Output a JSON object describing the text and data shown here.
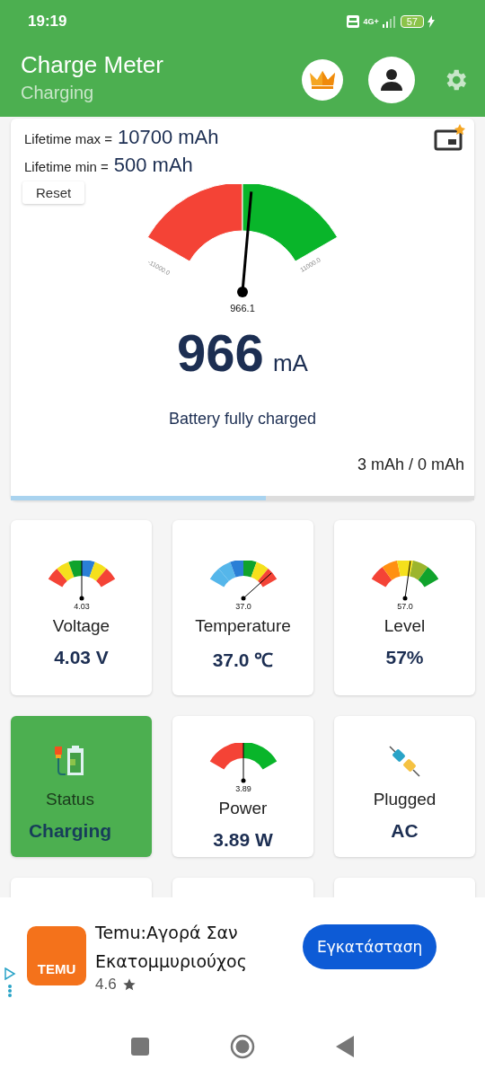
{
  "status_bar": {
    "time": "19:19",
    "network": "4G+",
    "battery": "57"
  },
  "app_bar": {
    "title": "Charge Meter",
    "subtitle": "Charging"
  },
  "summary": {
    "lifetime_max_label": "Lifetime max =",
    "lifetime_max": "10700 mAh",
    "lifetime_min_label": "Lifetime min =",
    "lifetime_min": "500 mAh",
    "reset_button": "Reset",
    "gauge": {
      "min_label": "-11000.0",
      "max_label": "11000.0",
      "reading": "966.1",
      "segments": [
        {
          "color": "#f44336"
        },
        {
          "color": "#09b52a"
        }
      ]
    },
    "current": "966",
    "unit": "mA",
    "message": "Battery fully charged",
    "capacity": "3 mAh / 0 mAh",
    "progress": {
      "level": 0.55
    }
  },
  "tiles": [
    {
      "kind": "gauge",
      "label": "Voltage",
      "value": "4.03 V",
      "active": false,
      "gauge": {
        "reading": "4.03",
        "segments": [
          {
            "color": "#f44336"
          },
          {
            "color": "#f5e01c"
          },
          {
            "color": "#10a32c"
          },
          {
            "color": "#2a7fd6"
          },
          {
            "color": "#f5e01c"
          },
          {
            "color": "#f44336"
          }
        ]
      }
    },
    {
      "kind": "gauge",
      "label": "Temperature",
      "value": "37.0 ℃",
      "active": false,
      "gauge": {
        "reading": "37.0",
        "segments": [
          {
            "color": "#55b6ea"
          },
          {
            "color": "#55b6ea"
          },
          {
            "color": "#2a7fd6"
          },
          {
            "color": "#10a32c"
          },
          {
            "color": "#f5e01c"
          },
          {
            "color": "#f44336"
          }
        ]
      }
    },
    {
      "kind": "gauge",
      "label": "Level",
      "value": "57%",
      "active": false,
      "gauge": {
        "reading": "57.0",
        "segments": [
          {
            "color": "#f44336"
          },
          {
            "color": "#ff9012"
          },
          {
            "color": "#f5e01c"
          },
          {
            "color": "#9cb52c"
          },
          {
            "color": "#10a32c"
          }
        ]
      }
    },
    {
      "kind": "status",
      "label": "Status",
      "value": "Charging",
      "active": true
    },
    {
      "kind": "gauge",
      "label": "Power",
      "value": "3.89 W",
      "active": false,
      "gauge": {
        "reading": "3.89",
        "segments": [
          {
            "color": "#f44336"
          },
          {
            "color": "#09b52a"
          }
        ]
      }
    },
    {
      "kind": "plug",
      "label": "Plugged",
      "value": "AC",
      "active": false
    },
    {
      "kind": "empty",
      "active": false
    },
    {
      "kind": "empty",
      "active": false
    },
    {
      "kind": "empty",
      "active": false
    }
  ],
  "ad": {
    "logo": "TEMU",
    "title": "Temu:Αγορά Σαν Εκατομμυριούχος",
    "rating": "4.6",
    "install_button": "Εγκατάσταση"
  }
}
